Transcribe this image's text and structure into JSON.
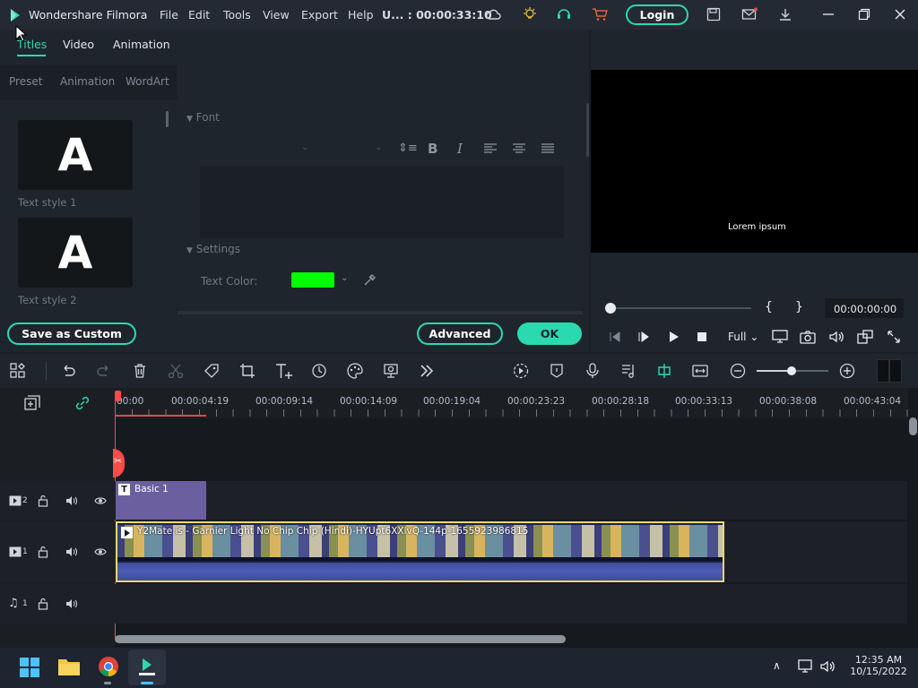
{
  "app": {
    "title": "Wondershare Filmora",
    "project": "U...",
    "timecode": "00:00:33:10"
  },
  "menu": [
    "File",
    "Edit",
    "Tools",
    "View",
    "Export",
    "Help"
  ],
  "login_label": "Login",
  "colors": {
    "accent": "#2bd9b0",
    "text_color_swatch": "#00ff00",
    "clip_border": "#f2d76b",
    "title_clip": "#6b5fa0"
  },
  "panel": {
    "tabs": [
      "Titles",
      "Video",
      "Animation"
    ],
    "subtabs": [
      "Preset",
      "Animation",
      "WordArt"
    ],
    "styles": [
      {
        "glyph": "A",
        "caption": "Text style 1"
      },
      {
        "glyph": "A",
        "caption": "Text style 2"
      }
    ],
    "font_section": "Font",
    "settings_section": "Settings",
    "text_color_label": "Text Color:",
    "save_custom": "Save as Custom",
    "advanced": "Advanced",
    "ok": "OK"
  },
  "preview": {
    "caption": "Lorem ipsum",
    "bracket_in": "{",
    "bracket_out": "}",
    "timecode": "00:00:00:00",
    "quality": "Full"
  },
  "ruler": [
    "00:00",
    "00:00:04:19",
    "00:00:09:14",
    "00:00:14:09",
    "00:00:19:04",
    "00:00:23:23",
    "00:00:28:18",
    "00:00:33:13",
    "00:00:38:08",
    "00:00:43:04"
  ],
  "tracks": {
    "title_track": {
      "number": "2",
      "clip": "Basic 1"
    },
    "video_track": {
      "number": "1",
      "clip": "Y2Mate.is - Garnier Light No Chip Chip (Hindi)-HYUpt6XXlvQ-144p-1655923986815"
    },
    "audio_track": {
      "number": "1"
    }
  },
  "taskbar": {
    "time": "12:35 AM",
    "date": "10/15/2022"
  }
}
